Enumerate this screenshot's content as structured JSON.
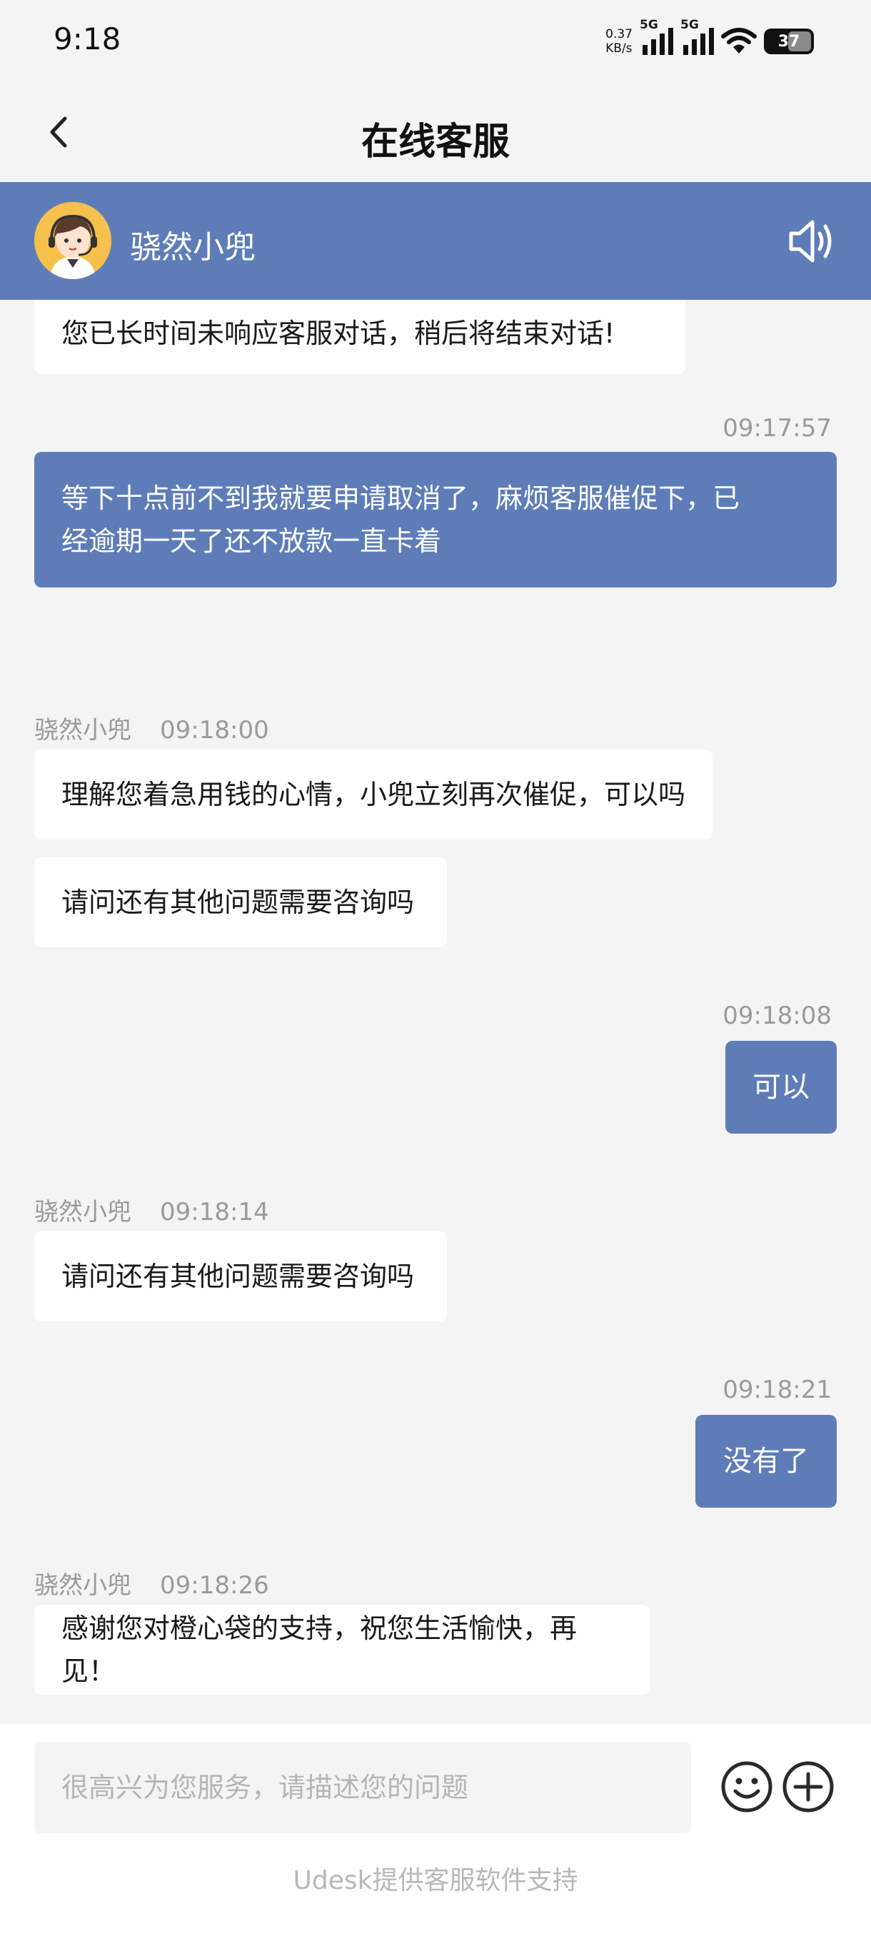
{
  "status_bar": {
    "time": "9:18",
    "net_speed_value": "0.37",
    "net_speed_unit": "KB/s",
    "signal1_label": "5G",
    "signal2_label": "5G",
    "battery": "37"
  },
  "header": {
    "title": "在线客服",
    "back_icon": "chevron-left-icon"
  },
  "agent_bar": {
    "name": "骁然小兜",
    "speaker_icon": "speaker-icon",
    "background": "#5e7db8"
  },
  "messages": [
    {
      "from": "agent",
      "text": "您已长时间未响应客服对话，稍后将结束对话!"
    },
    {
      "from": "user",
      "time": "09:17:57",
      "lines": [
        "等下十点前不到我就要申请取消了，麻烦客服催促下，已",
        "经逾期一天了还不放款一直卡着"
      ]
    },
    {
      "from": "agent",
      "sender": "骁然小兜",
      "time": "09:18:00",
      "text": "理解您着急用钱的心情，小兜立刻再次催促，可以吗"
    },
    {
      "from": "agent",
      "text": "请问还有其他问题需要咨询吗"
    },
    {
      "from": "user",
      "time": "09:18:08",
      "text": "可以"
    },
    {
      "from": "agent",
      "sender": "骁然小兜",
      "time": "09:18:14",
      "text": "请问还有其他问题需要咨询吗"
    },
    {
      "from": "user",
      "time": "09:18:21",
      "text": "没有了"
    },
    {
      "from": "agent",
      "sender": "骁然小兜",
      "time": "09:18:26",
      "text": "感谢您对橙心袋的支持，祝您生活愉快，再见！"
    }
  ],
  "input": {
    "placeholder": "很高兴为您服务，请描述您的问题",
    "emoji_icon": "emoji-icon",
    "plus_icon": "plus-circle-icon"
  },
  "footer": {
    "powered_by": "Udesk提供客服软件支持"
  },
  "colors": {
    "accent": "#5e7db8",
    "background": "#f4f4f4",
    "bubble_in": "#ffffff",
    "meta_text": "#9a9a9a"
  }
}
